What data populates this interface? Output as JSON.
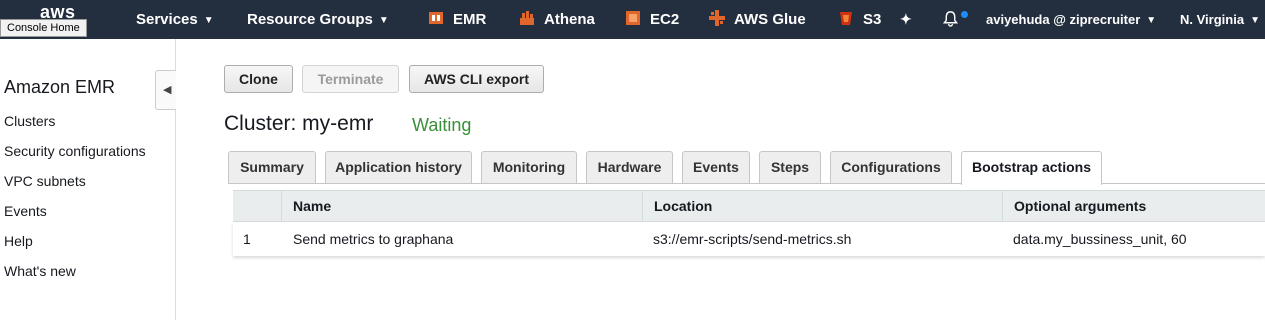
{
  "topnav": {
    "logo": "aws",
    "console_home_tooltip": "Console Home",
    "services_label": "Services",
    "resource_groups_label": "Resource Groups",
    "shortcuts": [
      {
        "label": "EMR",
        "icon": "emr-icon",
        "color": "#e0662b"
      },
      {
        "label": "Athena",
        "icon": "athena-icon",
        "color": "#e0662b"
      },
      {
        "label": "EC2",
        "icon": "ec2-icon",
        "color": "#e0662b"
      },
      {
        "label": "AWS Glue",
        "icon": "glue-icon",
        "color": "#e0662b"
      },
      {
        "label": "S3",
        "icon": "s3-icon",
        "color": "#d13212"
      }
    ],
    "pin_icon": "pin-icon",
    "bell_icon": "bell-icon",
    "user_label": "aviyehuda @ ziprecruiter",
    "region_label": "N. Virginia"
  },
  "sidebar": {
    "title": "Amazon EMR",
    "items": [
      "Clusters",
      "Security configurations",
      "VPC subnets",
      "Events",
      "Help",
      "What's new"
    ]
  },
  "toolbar": {
    "clone_label": "Clone",
    "terminate_label": "Terminate",
    "cli_export_label": "AWS CLI export"
  },
  "cluster": {
    "title": "Cluster: my-emr",
    "status": "Waiting",
    "status_color": "#3a8f3a"
  },
  "tabs": [
    "Summary",
    "Application history",
    "Monitoring",
    "Hardware",
    "Events",
    "Steps",
    "Configurations",
    "Bootstrap actions"
  ],
  "active_tab": "Bootstrap actions",
  "bootstrap_table": {
    "columns": [
      "Name",
      "Location",
      "Optional arguments"
    ],
    "rows": [
      {
        "index": "1",
        "name": "Send metrics to graphana",
        "location": "s3://emr-scripts/send-metrics.sh",
        "args": "data.my_bussiness_unit, 60"
      }
    ]
  }
}
